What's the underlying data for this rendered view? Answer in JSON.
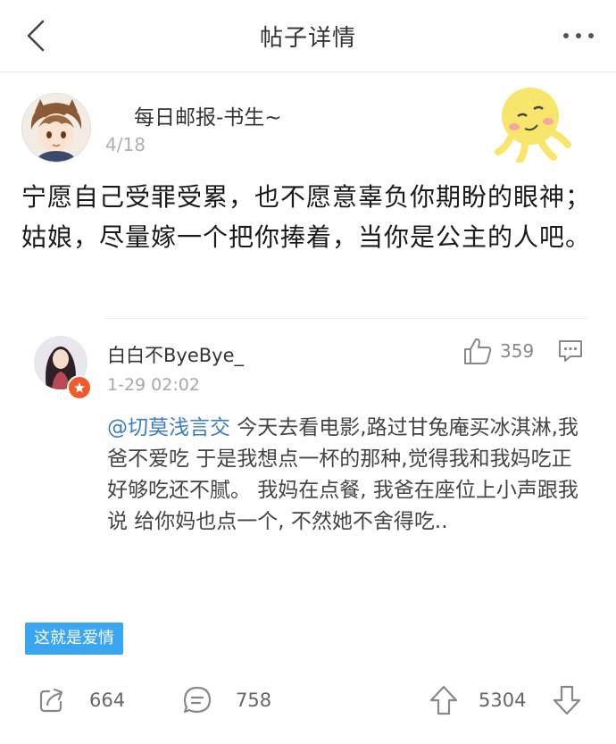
{
  "header": {
    "title": "帖子详情",
    "back_icon": "chevron-left-icon",
    "more_icon": "more-dots-icon"
  },
  "post": {
    "author": "每日邮报-书生~",
    "date": "4/18",
    "body": "宁愿自己受罪受累，也不愿意辜负你期盼的眼神；姑娘，尽量嫁一个把你捧着，当你是公主的人吧。"
  },
  "comment": {
    "username": "白白不ByeBye_",
    "time": "1-29 02:02",
    "likes": "359",
    "mention": "@切莫浅言交",
    "text": " 今天去看电影,路过甘兔庵买冰淇淋,我爸不爱吃 于是我想点一杯的那种,觉得我和我妈吃正好够吃还不腻。 我妈在点餐, 我爸在座位上小声跟我说 给你妈也点一个, 不然她不舍得吃.."
  },
  "tag": {
    "label": "这就是爱情"
  },
  "footer": {
    "share_count": "664",
    "comment_count": "758",
    "vote_count": "5304"
  },
  "colors": {
    "tag_bg": "#3aa5f0",
    "mention": "#3b7dc4",
    "badge": "#f25a2a",
    "sticker": "#f7e66b"
  }
}
